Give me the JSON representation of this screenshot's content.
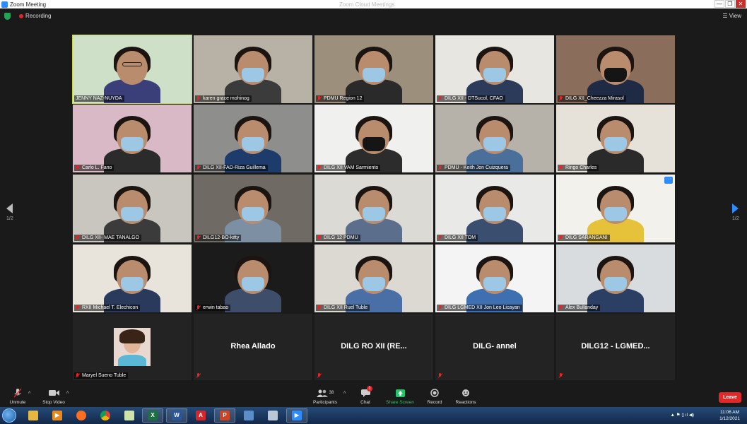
{
  "window": {
    "title": "Zoom Meeting",
    "center_title": "Zoom Cloud Meetings",
    "min": "—",
    "max": "❐",
    "close": "✕"
  },
  "topbar": {
    "recording_label": "Recording",
    "view_label": "View"
  },
  "pager": {
    "left": "1/2",
    "right": "1/2"
  },
  "participants": [
    "JENNY NAZ-NUYDA",
    "karen grace mohinog",
    "PDMU Region 12",
    "DILG XII - DTSucol, CFAO",
    "DILG XII_Cheezza Mirasol",
    "Carlo L. Fano",
    "DILG XII-FAD-Riza Guillema",
    "DILG XII VAM Sarmiento",
    "PDMU - Keith Jon Cuizquera",
    "Ringo Charles",
    "DILG XII- MAE TANALGO",
    "DILG12-BO-kitty",
    "DILG 12 PDMU",
    "DILG XII TOM",
    "DILG SARANGANI",
    "RXII Michael T. Elechicon",
    "erwin tabao",
    "DILG XII Ruel Tuble",
    "DILG LGMED XII Jon Leo Licayan",
    "Alex Bullanday",
    "Maryel Sueno Tuble",
    "",
    "",
    "",
    ""
  ],
  "name_only": [
    "Rhea Allado",
    "DILG RO XII (RE...",
    "DILG- annel",
    "DILG12 - LGMED..."
  ],
  "toolbar": {
    "unmute": "Unmute",
    "stop_video": "Stop Video",
    "participants": "Participants",
    "participants_count": "38",
    "chat": "Chat",
    "chat_badge": "1",
    "share_screen": "Share Screen",
    "record": "Record",
    "reactions": "Reactions",
    "leave": "Leave"
  },
  "taskbar": {
    "time": "11:06 AM",
    "date": "1/12/2021"
  },
  "colors": {
    "accent": "#2d8cff",
    "share": "#23c46a",
    "leave": "#e02828",
    "active_border": "#c9d63a"
  }
}
